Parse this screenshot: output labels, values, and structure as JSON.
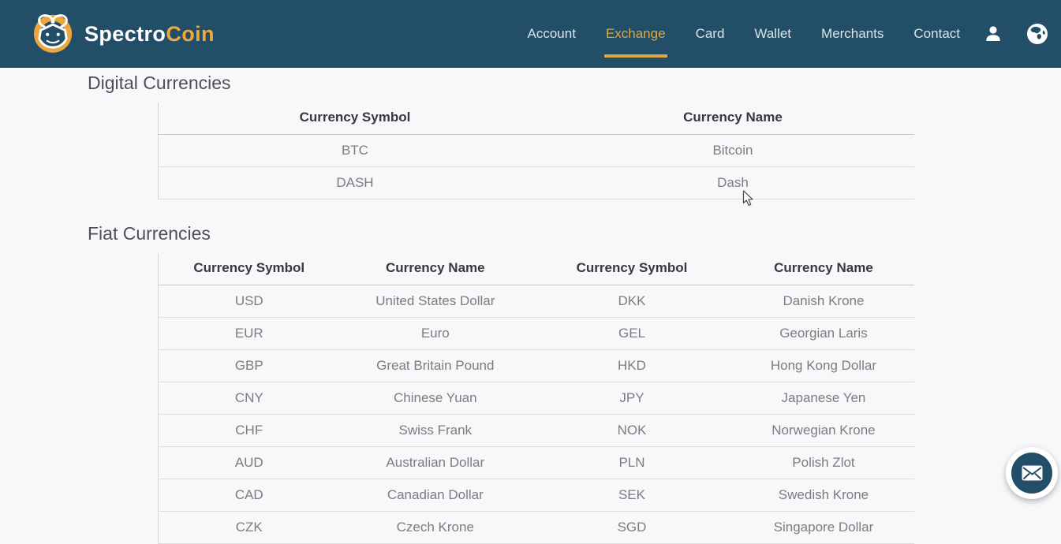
{
  "brand": {
    "name_part1": "Spectro",
    "name_part2": "Coin"
  },
  "nav": {
    "items": [
      {
        "label": "Account",
        "active": false
      },
      {
        "label": "Exchange",
        "active": true
      },
      {
        "label": "Card",
        "active": false
      },
      {
        "label": "Wallet",
        "active": false
      },
      {
        "label": "Merchants",
        "active": false
      },
      {
        "label": "Contact",
        "active": false
      }
    ],
    "icons": [
      "user-icon",
      "globe-icon"
    ]
  },
  "sections": {
    "digital": {
      "title": "Digital Currencies",
      "columns": [
        "Currency Symbol",
        "Currency Name"
      ],
      "rows": [
        [
          "BTC",
          "Bitcoin"
        ],
        [
          "DASH",
          "Dash"
        ]
      ]
    },
    "fiat": {
      "title": "Fiat Currencies",
      "columns": [
        "Currency Symbol",
        "Currency Name",
        "Currency Symbol",
        "Currency Name"
      ],
      "rows": [
        [
          "USD",
          "United States Dollar",
          "DKK",
          "Danish Krone"
        ],
        [
          "EUR",
          "Euro",
          "GEL",
          "Georgian Laris"
        ],
        [
          "GBP",
          "Great Britain Pound",
          "HKD",
          "Hong Kong Dollar"
        ],
        [
          "CNY",
          "Chinese Yuan",
          "JPY",
          "Japanese Yen"
        ],
        [
          "CHF",
          "Swiss Frank",
          "NOK",
          "Norwegian Krone"
        ],
        [
          "AUD",
          "Australian Dollar",
          "PLN",
          "Polish Zlot"
        ],
        [
          "CAD",
          "Canadian Dollar",
          "SEK",
          "Swedish Krone"
        ],
        [
          "CZK",
          "Czech Krone",
          "SGD",
          "Singapore Dollar"
        ]
      ]
    }
  },
  "floating": {
    "mail_button_icon": "mail-envelope-icon"
  },
  "colors": {
    "navbar": "#234e68",
    "accent_gold": "#dfa743",
    "page_bg": "#f8f7f9",
    "header_text": "#36393d",
    "cell_text": "#7a7d81"
  }
}
